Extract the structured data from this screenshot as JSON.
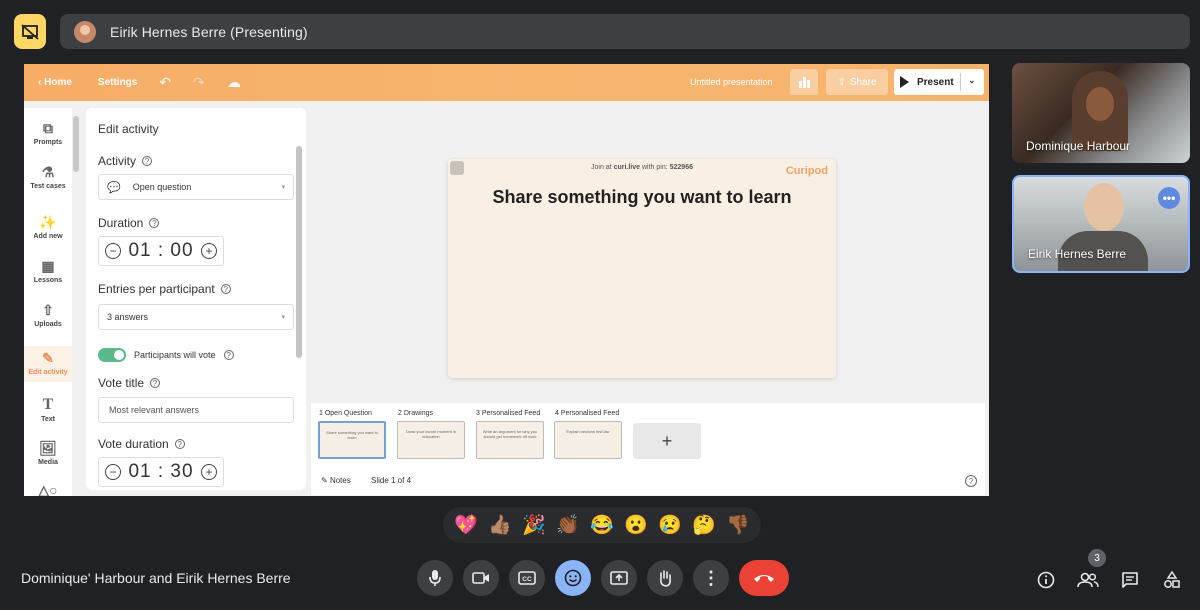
{
  "banner": {
    "presenter_text": "Eirik Hernes Berre (Presenting)"
  },
  "app": {
    "home_label": "Home",
    "settings_label": "Settings",
    "title": "Untitled presentation",
    "share_label": "Share",
    "present_label": "Present"
  },
  "rail": {
    "items": [
      {
        "label": "Prompts",
        "icon": "prompts-icon"
      },
      {
        "label": "Test cases",
        "icon": "flask-icon"
      },
      {
        "label": "Add new",
        "icon": "magic-wand-icon"
      },
      {
        "label": "Lessons",
        "icon": "grid-icon"
      },
      {
        "label": "Uploads",
        "icon": "upload-icon"
      },
      {
        "label": "Edit activity",
        "icon": "edit-activity-icon"
      },
      {
        "label": "Text",
        "icon": "text-icon"
      },
      {
        "label": "Media",
        "icon": "image-icon"
      }
    ]
  },
  "edit": {
    "title": "Edit activity",
    "activity_label": "Activity",
    "activity_value": "Open question",
    "duration_label": "Duration",
    "duration_value": "01 : 00",
    "entries_label": "Entries per participant",
    "entries_value": "3 answers",
    "vote_toggle_label": "Participants will vote",
    "vote_title_label": "Vote title",
    "vote_title_value": "Most relevant answers",
    "vote_duration_label": "Vote duration",
    "vote_duration_value": "01 : 30"
  },
  "slide": {
    "join_prefix": "Join at ",
    "join_site": "curi.live",
    "join_mid": " with pin: ",
    "join_pin": "522966",
    "logo": "Curipod",
    "question": "Share something you want to learn"
  },
  "slides": [
    {
      "label": "1 Open Question",
      "preview": "Share something you want to learn"
    },
    {
      "label": "2 Drawings",
      "preview": "Draw your favorit moment in education"
    },
    {
      "label": "3 Personalised Feed",
      "preview": "Write an argument for why you should get homework off work"
    },
    {
      "label": "4 Personalised Feed",
      "preview": "Explain neutons first law"
    }
  ],
  "strip": {
    "notes_label": "Notes",
    "slide_counter": "Slide 1 of 4",
    "add_symbol": "+",
    "help_symbol": "?"
  },
  "participants": [
    {
      "name": "Dominique Harbour"
    },
    {
      "name": "Eirik Hernes Berre"
    }
  ],
  "reactions": [
    "💖",
    "👍🏽",
    "🎉",
    "👏🏾",
    "😂",
    "😮",
    "😢",
    "🤔",
    "👎🏾"
  ],
  "meeting": {
    "title": "Dominique' Harbour and Eirik Hernes Berre"
  },
  "controls": [
    "microphone-icon",
    "camera-icon",
    "captions-icon",
    "emoji-icon",
    "present-icon",
    "raise-hand-icon",
    "more-options-icon",
    "end-call-icon"
  ],
  "people_count": "3",
  "colors": {
    "accent": "#8ab4f8",
    "end_call": "#ea4335",
    "stop_present": "#fdd663",
    "brand_orange": "#f6ad66"
  }
}
